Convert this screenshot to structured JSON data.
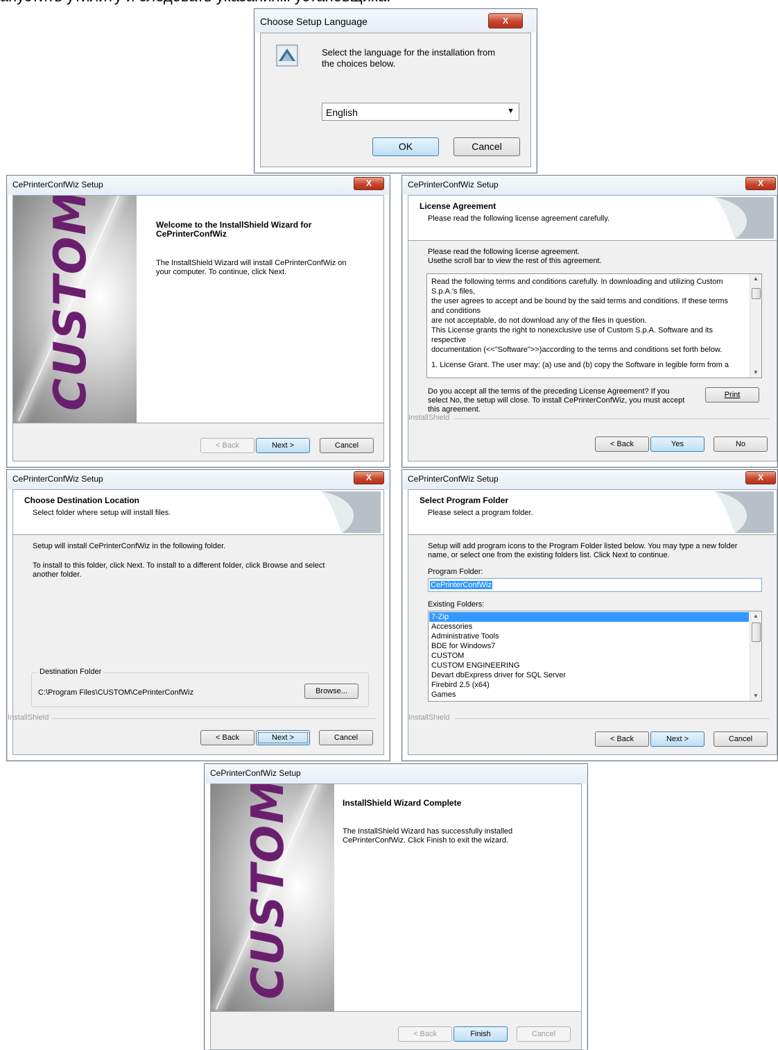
{
  "caption": "апустить утилиту и следовать указаниям установщика.",
  "lang_dialog": {
    "title": "Choose Setup Language",
    "close": "X",
    "prompt_line1": "Select the language for the installation from",
    "prompt_line2": "the choices below.",
    "selected_language": "English",
    "ok": "OK",
    "cancel": "Cancel"
  },
  "welcome": {
    "title": "CePrinterConfWiz Setup",
    "close": "X",
    "brand": "CUSTOM",
    "reg_mark": "®",
    "heading_line1": "Welcome to the InstallShield Wizard for",
    "heading_line2": "CePrinterConfWiz",
    "body_line1": "The InstallShield Wizard will install CePrinterConfWiz on",
    "body_line2": "your computer.  To continue, click Next.",
    "back": "< Back",
    "next": "Next >",
    "cancel": "Cancel"
  },
  "license": {
    "title": "CePrinterConfWiz Setup",
    "close": "X",
    "heading": "License Agreement",
    "subheading": "Please read the following license agreement carefully.",
    "intro_line1": "Please read the following license agreement.",
    "intro_line2": "Usethe scroll bar to view the rest of this agreement.",
    "text_lines": [
      "Read the following terms and conditions carefully. In downloading and utilizing Custom",
      "S.p.A.'s files,",
      "the user agrees to accept and be bound by the said terms and conditions. If these terms",
      "and conditions",
      "are not acceptable, do not download any of the files in question.",
      "This License grants the right to nonexclusive use of Custom S.p.A. Software and its",
      "respective",
      "documentation (<<\"Software\">>)according to the terms and conditions set forth below.",
      "",
      "1. License Grant. The user may: (a) use and (b) copy the Software in legible form from a"
    ],
    "question_line1": "Do you accept all the terms of the preceding License Agreement?  If you",
    "question_line2": "select No,  the setup will close.  To install CePrinterConfWiz, you must accept",
    "question_line3": "this agreement.",
    "print": "Print",
    "installshield": "InstallShield",
    "back": "< Back",
    "yes": "Yes",
    "no": "No"
  },
  "destination": {
    "title": "CePrinterConfWiz Setup",
    "close": "X",
    "heading": "Choose Destination Location",
    "subheading": "Select folder where setup will install files.",
    "line1": "Setup will install CePrinterConfWiz in the following folder.",
    "line2": "To install to this folder, click Next. To install to a different folder, click Browse and select",
    "line3": "another folder.",
    "group_label": "Destination Folder",
    "path": "C:\\Program Files\\CUSTOM\\CePrinterConfWiz",
    "browse": "Browse...",
    "installshield": "InstallShield",
    "back": "< Back",
    "next": "Next >",
    "cancel": "Cancel"
  },
  "program_folder": {
    "title": "CePrinterConfWiz Setup",
    "close": "X",
    "heading": "Select Program Folder",
    "subheading": "Please select a program folder.",
    "line1": "Setup will add program icons to the Program Folder listed below.  You may type a new folder",
    "line2": "name, or select one from the existing folders list.  Click Next to continue.",
    "program_folder_label": "Program Folder:",
    "program_folder_value": "CePrinterConfWiz",
    "existing_label": "Existing Folders:",
    "folders": [
      "7-Zip",
      "Accessories",
      "Administrative Tools",
      "BDE for Windows7",
      "CUSTOM",
      "CUSTOM ENGINEERING",
      "Devart dbExpress driver for SQL Server",
      "Firebird 2.5 (x64)",
      "Games"
    ],
    "installshield": "InstallShield",
    "back": "< Back",
    "next": "Next >",
    "cancel": "Cancel"
  },
  "complete": {
    "title": "CePrinterConfWiz Setup",
    "brand": "CUSTOM",
    "reg_mark": "®",
    "heading": "InstallShield Wizard Complete",
    "body_line1": "The InstallShield Wizard has successfully installed",
    "body_line2": "CePrinterConfWiz.  Click Finish to exit the wizard.",
    "back": "< Back",
    "finish": "Finish",
    "cancel": "Cancel"
  }
}
